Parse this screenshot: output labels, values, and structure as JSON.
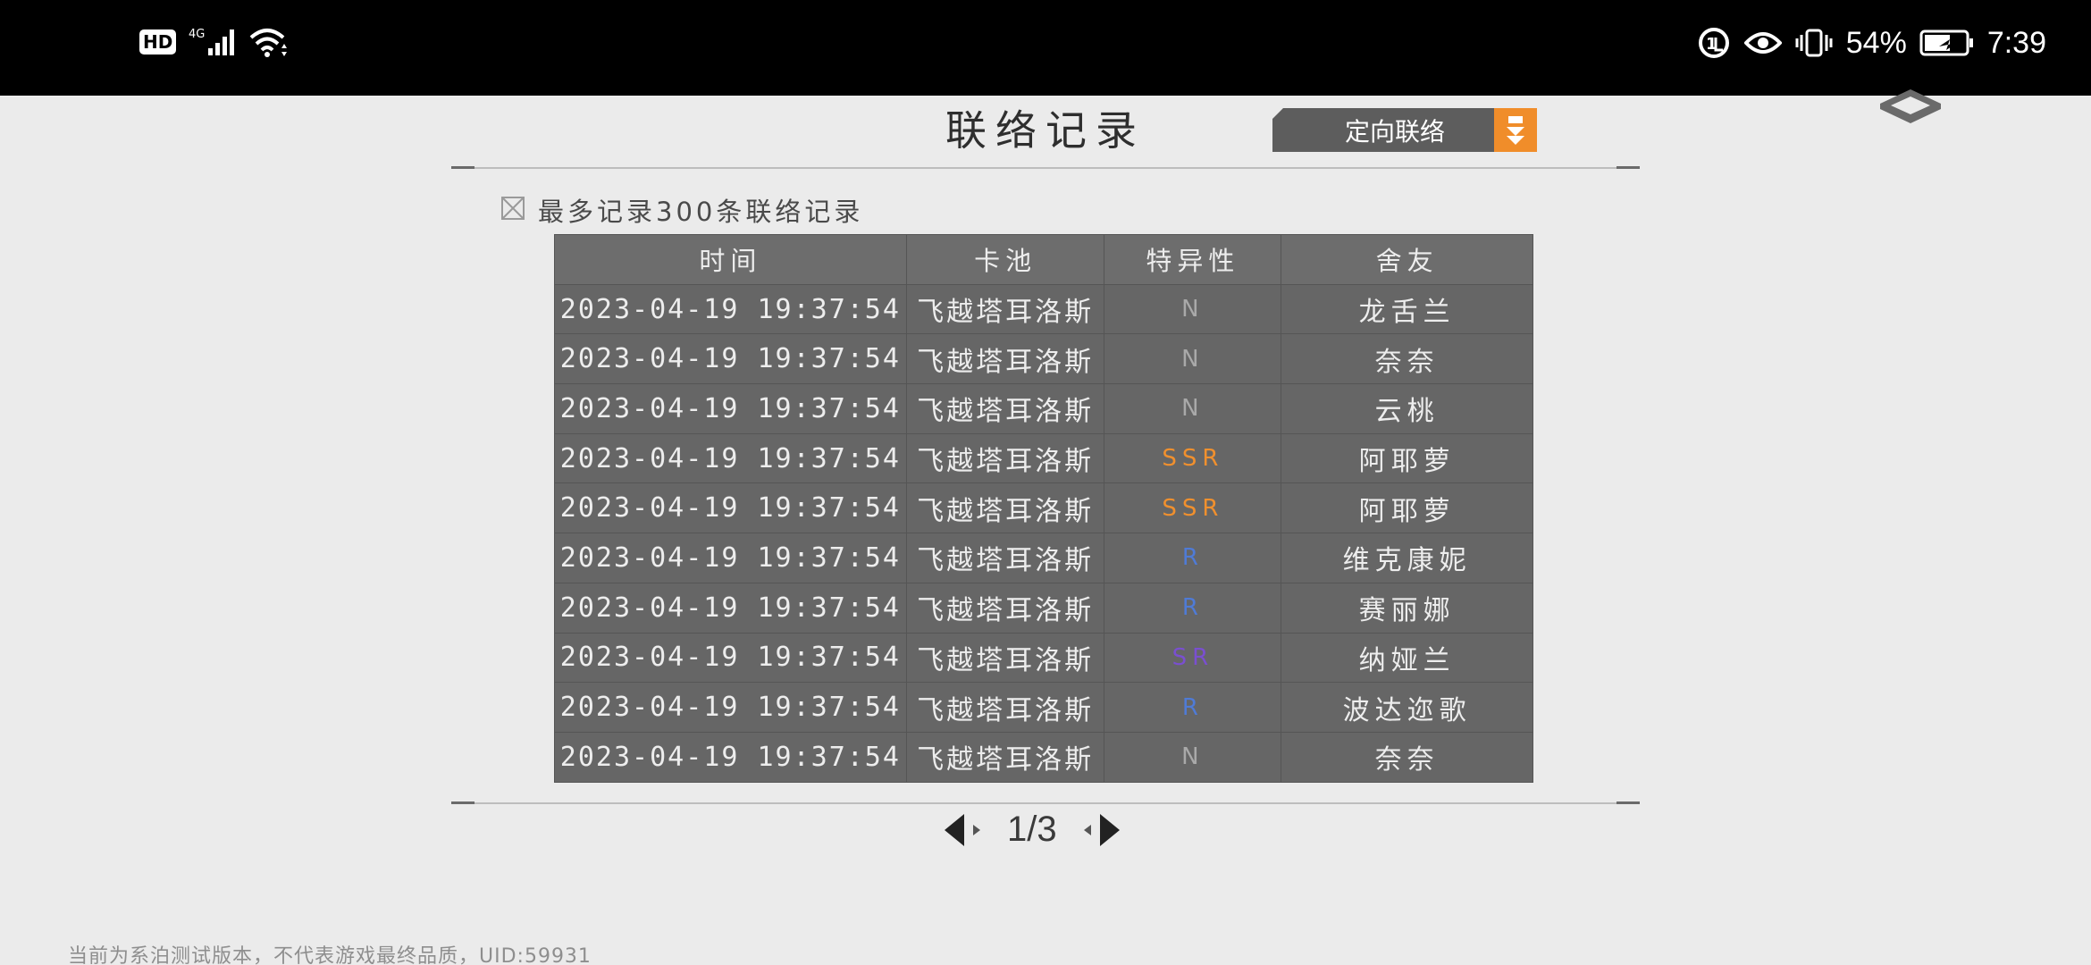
{
  "status_bar": {
    "hd_badge": "HD",
    "network": "4G",
    "battery_percent": "54%",
    "time": "7:39",
    "icons": [
      "signal-icon",
      "wifi-icon",
      "data-saver-icon",
      "eye-icon",
      "vibrate-icon",
      "battery-icon"
    ]
  },
  "header": {
    "title": "联络记录",
    "filter_label": "定向联络"
  },
  "note": "最多记录300条联络记录",
  "table": {
    "columns": [
      "时间",
      "卡池",
      "特异性",
      "舍友"
    ],
    "rows": [
      {
        "time": "2023-04-19 19:37:54",
        "pool": "飞越塔耳洛斯",
        "rarity": "N",
        "friend": "龙舌兰"
      },
      {
        "time": "2023-04-19 19:37:54",
        "pool": "飞越塔耳洛斯",
        "rarity": "N",
        "friend": "奈奈"
      },
      {
        "time": "2023-04-19 19:37:54",
        "pool": "飞越塔耳洛斯",
        "rarity": "N",
        "friend": "云桃"
      },
      {
        "time": "2023-04-19 19:37:54",
        "pool": "飞越塔耳洛斯",
        "rarity": "SSR",
        "friend": "阿耶萝"
      },
      {
        "time": "2023-04-19 19:37:54",
        "pool": "飞越塔耳洛斯",
        "rarity": "SSR",
        "friend": "阿耶萝"
      },
      {
        "time": "2023-04-19 19:37:54",
        "pool": "飞越塔耳洛斯",
        "rarity": "R",
        "friend": "维克康妮"
      },
      {
        "time": "2023-04-19 19:37:54",
        "pool": "飞越塔耳洛斯",
        "rarity": "R",
        "friend": "赛丽娜"
      },
      {
        "time": "2023-04-19 19:37:54",
        "pool": "飞越塔耳洛斯",
        "rarity": "SR",
        "friend": "纳娅兰"
      },
      {
        "time": "2023-04-19 19:37:54",
        "pool": "飞越塔耳洛斯",
        "rarity": "R",
        "friend": "波达迩歌"
      },
      {
        "time": "2023-04-19 19:37:54",
        "pool": "飞越塔耳洛斯",
        "rarity": "N",
        "friend": "奈奈"
      }
    ]
  },
  "rarity_colors": {
    "N": "#a9a9a9",
    "R": "#4f7bd6",
    "SR": "#7a4fd0",
    "SSR": "#f0902e"
  },
  "pager": {
    "indicator": "1/3"
  },
  "footer": "当前为系泊测试版本，不代表游戏最终品质，UID:59931"
}
